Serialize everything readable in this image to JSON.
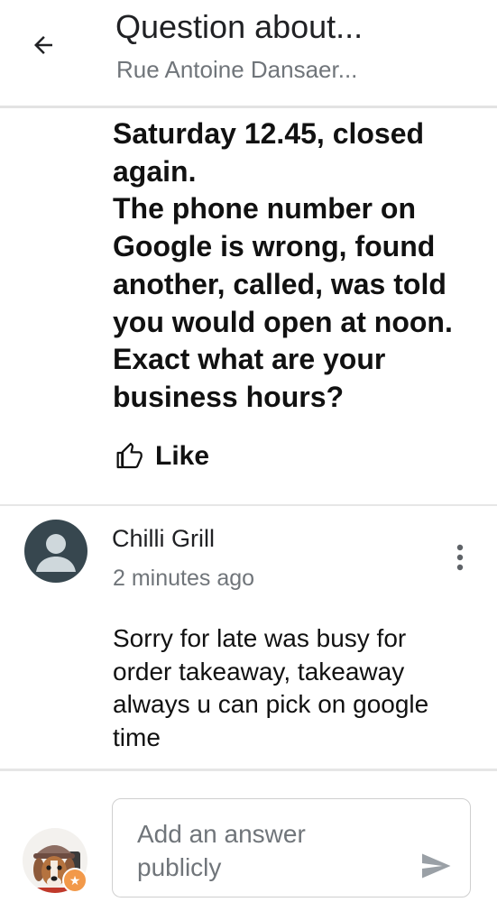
{
  "header": {
    "back_icon": "arrow-back-icon",
    "title": "Question about...",
    "subtitle": "Rue Antoine Dansaer..."
  },
  "question": {
    "text": "Saturday 12.45, closed\nagain.\nThe phone number on\nGoogle is wrong, found\nanother, called, was told\nyou would open at noon.\nExact what are your\nbusiness hours?",
    "like_icon": "thumbs-up-icon",
    "like_label": "Like"
  },
  "answer": {
    "avatar_icon": "default-person-icon",
    "author": "Chilli Grill",
    "time": "2 minutes ago",
    "more_icon": "more-vertical-icon",
    "text": "Sorry for  late was busy for\norder takeaway, takeaway\nalways u can pick on google\ntime"
  },
  "compose": {
    "avatar_icon": "user-avatar-dog-icon",
    "badge_icon": "local-guide-star-icon",
    "placeholder": "Add an answer publicly",
    "send_icon": "send-icon"
  },
  "colors": {
    "primary_text": "#202124",
    "secondary_text": "#70757a",
    "divider": "#e6e6e6",
    "avatar_bg": "#37474f",
    "badge": "#f2994a",
    "send_icon": "#9aa0a6"
  }
}
